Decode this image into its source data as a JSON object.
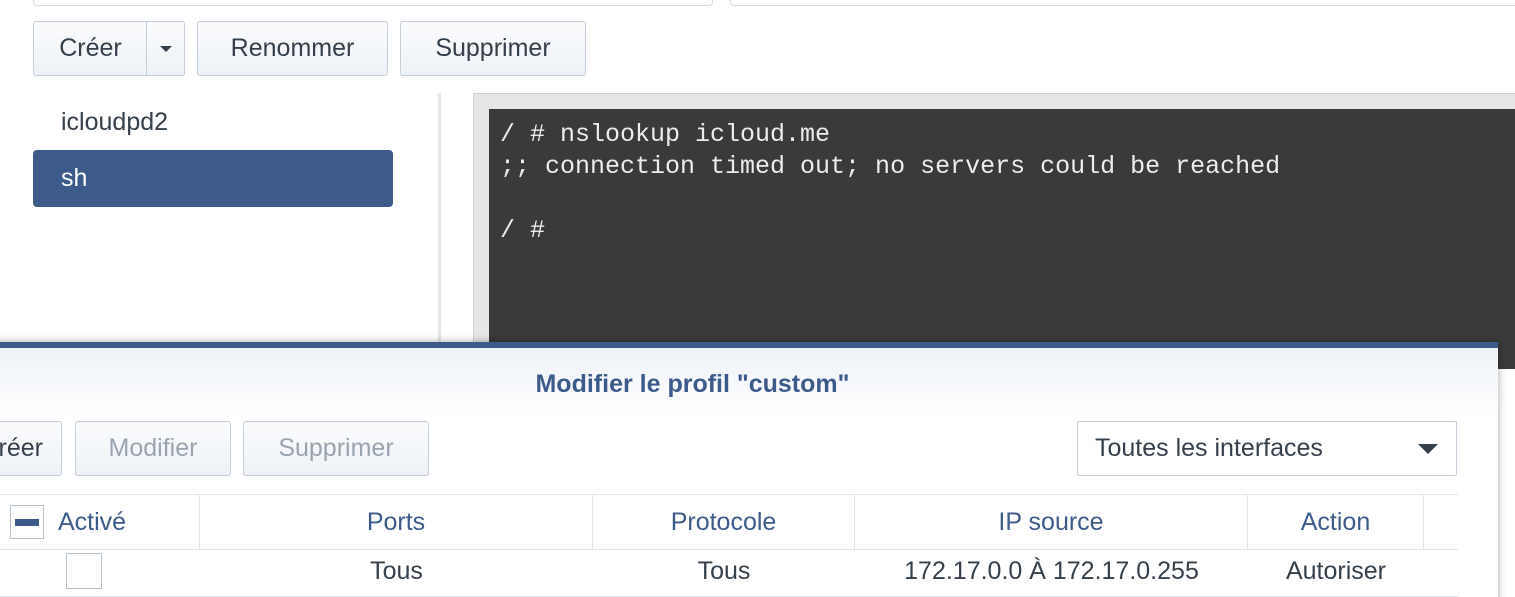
{
  "toolbar": {
    "create_label": "Créer",
    "rename_label": "Renommer",
    "delete_label": "Supprimer"
  },
  "container_list": {
    "items": [
      {
        "label": "icloudpd2",
        "selected": false
      },
      {
        "label": "sh",
        "selected": true
      }
    ]
  },
  "terminal": {
    "lines": [
      "/ # nslookup icloud.me",
      ";; connection timed out; no servers could be reached",
      "",
      "/ #"
    ]
  },
  "modal": {
    "title": "Modifier le profil \"custom\"",
    "create_label": "Créer",
    "modify_label": "Modifier",
    "delete_label": "Supprimer",
    "interface_select": {
      "selected": "Toutes les interfaces"
    },
    "table": {
      "headers": {
        "active": "Activé",
        "ports": "Ports",
        "protocol": "Protocole",
        "source_ip": "IP source",
        "action": "Action"
      },
      "rows": [
        {
          "active": false,
          "ports": "Tous",
          "protocol": "Tous",
          "source_ip": "172.17.0.0 À 172.17.0.255",
          "action": "Autoriser"
        }
      ]
    }
  },
  "colors": {
    "accent": "#3d5b8a",
    "terminal_bg": "#3a3a3a",
    "terminal_fg": "#ececec",
    "text": "#36404b",
    "disabled_text": "#9aa4ae"
  }
}
